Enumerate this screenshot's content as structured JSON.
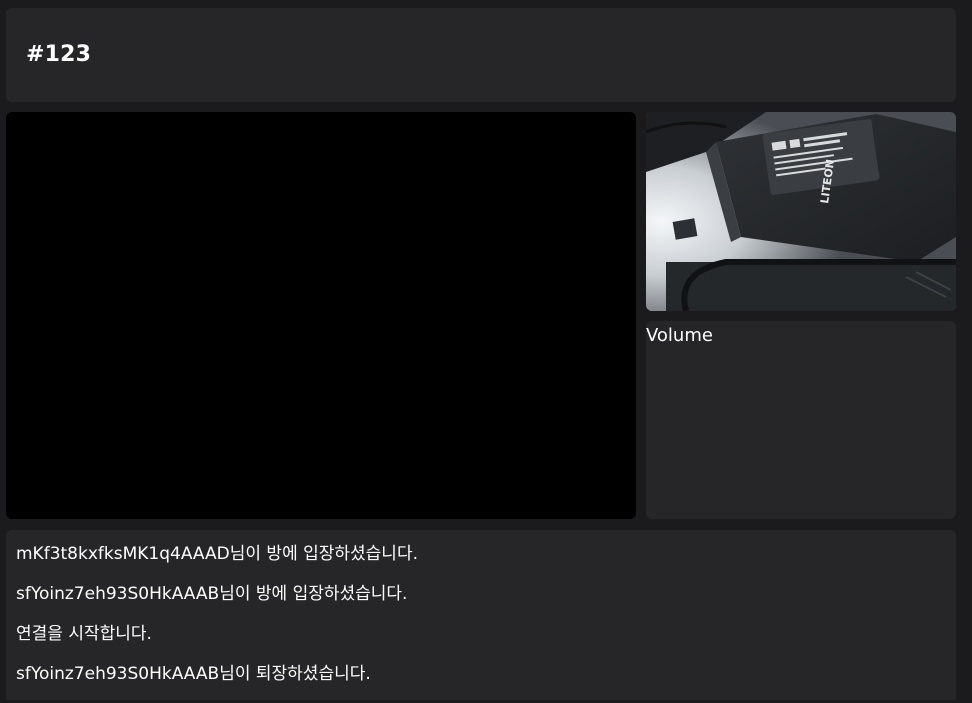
{
  "header": {
    "room_title": "#123"
  },
  "media": {
    "volume_label": "Volume",
    "camera_label_text": "LITEON"
  },
  "log": {
    "messages": [
      "mKf3t8kxfksMK1q4AAAD님이 방에 입장하셨습니다.",
      "sfYoinz7eh93S0HkAAAB님이 방에 입장하셨습니다.",
      "연결을 시작합니다.",
      "sfYoinz7eh93S0HkAAAB님이 퇴장하셨습니다."
    ]
  },
  "colors": {
    "background": "#1b1b1d",
    "panel": "#262628",
    "video": "#000000",
    "text": "#ffffff"
  }
}
